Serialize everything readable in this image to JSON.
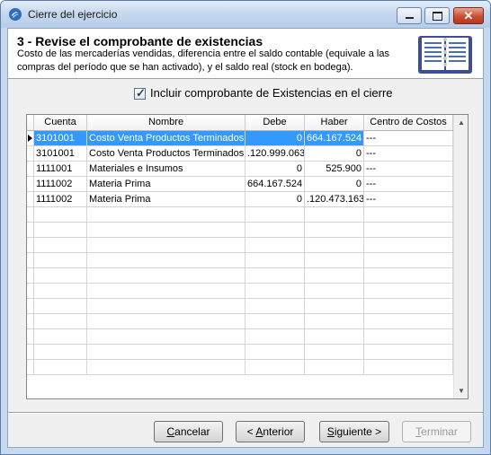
{
  "window": {
    "title": "Cierre del ejercicio",
    "controls": {
      "minimize": "minimize",
      "maximize": "maximize",
      "close": "✕"
    }
  },
  "header": {
    "title": "3 - Revise el comprobante de existencias",
    "description": "Costo de las mercaderías vendidas, diferencia entre el saldo contable (equivale a las compras del período que se han activado), y el saldo real (stock en bodega)."
  },
  "checkbox": {
    "label": "Incluir comprobante de Existencias en el cierre",
    "checked": true
  },
  "grid": {
    "columns": [
      "Cuenta",
      "Nombre",
      "Debe",
      "Haber",
      "Centro de Costos"
    ],
    "rows": [
      {
        "cuenta": "3101001",
        "nombre": "Costo Venta Productos Terminados",
        "debe": "0",
        "haber": "664.167.524",
        "centro": "---"
      },
      {
        "cuenta": "3101001",
        "nombre": "Costo Venta Productos Terminados",
        "debe": ".120.999.063",
        "haber": "0",
        "centro": "---"
      },
      {
        "cuenta": "1111001",
        "nombre": "Materiales e Insumos",
        "debe": "0",
        "haber": "525.900",
        "centro": "---"
      },
      {
        "cuenta": "1111002",
        "nombre": "Materia Prima",
        "debe": "664.167.524",
        "haber": "0",
        "centro": "---"
      },
      {
        "cuenta": "1111002",
        "nombre": "Materia Prima",
        "debe": "0",
        "haber": ".120.473.163",
        "centro": "---"
      }
    ],
    "selected_row": 0,
    "empty_rows": 11
  },
  "buttons": {
    "cancel": {
      "prefix": "",
      "accel": "C",
      "rest": "ancelar"
    },
    "back": {
      "prefix": "< ",
      "accel": "A",
      "rest": "nterior"
    },
    "next": {
      "prefix": "",
      "accel": "S",
      "rest": "iguiente >"
    },
    "finish": {
      "prefix": "",
      "accel": "T",
      "rest": "erminar"
    }
  },
  "colors": {
    "selection": "#3399ff",
    "title_bar": "#c4d7ee",
    "close_button": "#c94e33"
  }
}
